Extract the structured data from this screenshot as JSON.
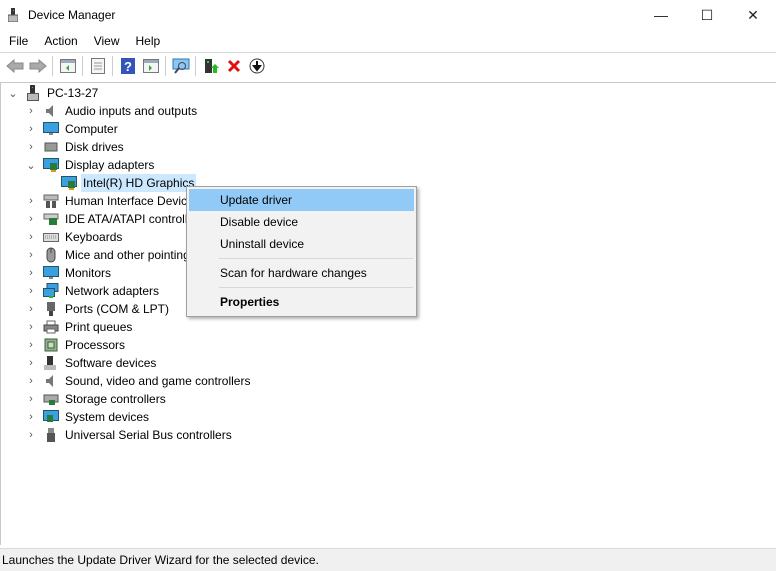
{
  "window": {
    "title": "Device Manager",
    "minimize": "—",
    "maximize": "☐",
    "close": "✕"
  },
  "menu": [
    "File",
    "Action",
    "View",
    "Help"
  ],
  "toolbar": [
    "back-icon",
    "forward-icon",
    "show-hide-console-tree-icon",
    "properties-icon",
    "help-icon",
    "action-pane-icon",
    "scan-hardware-icon",
    "update-driver-icon",
    "uninstall-icon",
    "disable-icon"
  ],
  "tree": {
    "root": "PC-13-27",
    "items": [
      {
        "label": "Audio inputs and outputs",
        "icon": "speaker-icon",
        "expanded": false
      },
      {
        "label": "Computer",
        "icon": "monitor-icon",
        "expanded": false
      },
      {
        "label": "Disk drives",
        "icon": "disk-icon",
        "expanded": false
      },
      {
        "label": "Display adapters",
        "icon": "display-adapter-icon",
        "expanded": true,
        "children": [
          {
            "label": "Intel(R) HD Graphics",
            "selected": true
          }
        ]
      },
      {
        "label": "Human Interface Devices",
        "icon": "hid-icon",
        "expanded": false
      },
      {
        "label": "IDE ATA/ATAPI controllers",
        "icon": "ide-icon",
        "expanded": false
      },
      {
        "label": "Keyboards",
        "icon": "keyboard-icon",
        "expanded": false
      },
      {
        "label": "Mice and other pointing devices",
        "icon": "mouse-icon",
        "expanded": false
      },
      {
        "label": "Monitors",
        "icon": "monitor-icon",
        "expanded": false
      },
      {
        "label": "Network adapters",
        "icon": "network-icon",
        "expanded": false
      },
      {
        "label": "Ports (COM & LPT)",
        "icon": "port-icon",
        "expanded": false
      },
      {
        "label": "Print queues",
        "icon": "printer-icon",
        "expanded": false
      },
      {
        "label": "Processors",
        "icon": "processor-icon",
        "expanded": false
      },
      {
        "label": "Software devices",
        "icon": "software-icon",
        "expanded": false
      },
      {
        "label": "Sound, video and game controllers",
        "icon": "speaker-icon",
        "expanded": false
      },
      {
        "label": "Storage controllers",
        "icon": "storage-icon",
        "expanded": false
      },
      {
        "label": "System devices",
        "icon": "system-icon",
        "expanded": false
      },
      {
        "label": "Universal Serial Bus controllers",
        "icon": "usb-icon",
        "expanded": false
      }
    ]
  },
  "context_menu": {
    "update": "Update driver",
    "disable": "Disable device",
    "uninstall": "Uninstall device",
    "scan": "Scan for hardware changes",
    "properties": "Properties"
  },
  "status": "Launches the Update Driver Wizard for the selected device.",
  "colors": {
    "selection": "#cce8ff",
    "menu_highlight": "#91c9f7"
  }
}
